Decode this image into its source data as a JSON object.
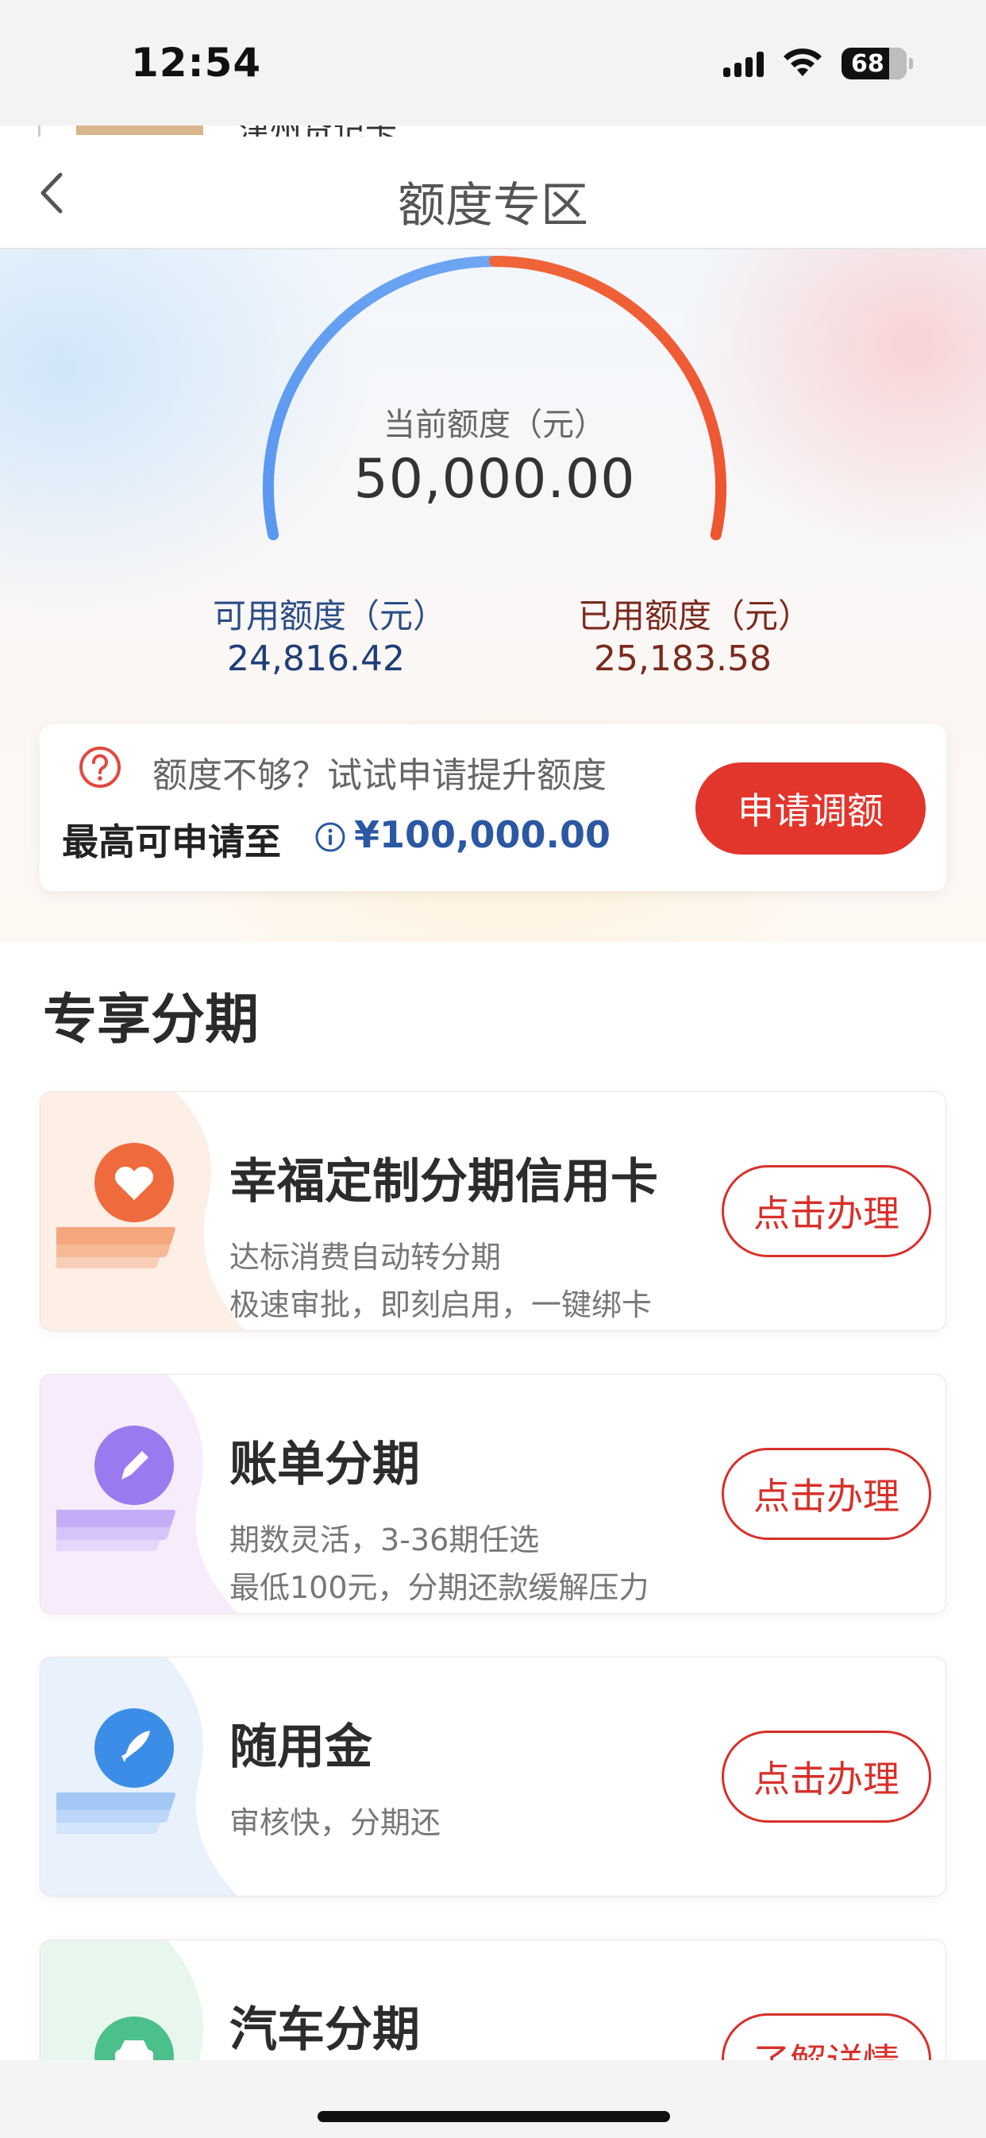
{
  "status_bar": {
    "time": "12:54",
    "battery": "68",
    "icons": [
      "signal-icon",
      "wifi-icon",
      "battery-icon"
    ]
  },
  "background_page": {
    "partial_text": "津州贷记卡"
  },
  "nav": {
    "title": "额度专区",
    "back_icon": "chevron-left-icon"
  },
  "credit": {
    "current_label": "当前额度（元）",
    "current_value": "50,000.00",
    "available_label": "可用额度（元）",
    "available_value": "24,816.42",
    "used_label": "已用额度（元）",
    "used_value": "25,183.58",
    "used_fraction": 0.5037,
    "colors": {
      "available": "#5b9cf0",
      "used": "#ee5a35"
    }
  },
  "quota_card": {
    "hint": "额度不够？试试申请提升额度",
    "max_label": "最高可申请至",
    "max_value": "¥100,000.00",
    "apply_button": "申请调额"
  },
  "section": {
    "title": "专享分期"
  },
  "products": [
    {
      "title": "幸福定制分期信用卡",
      "desc": [
        "达标消费自动转分期",
        "极速审批，即刻启用，一键绑卡"
      ],
      "button": "点击办理",
      "icon": "heart-icon",
      "color": "#ef6b3d"
    },
    {
      "title": "账单分期",
      "desc": [
        "期数灵活，3-36期任选",
        "最低100元，分期还款缓解压力"
      ],
      "button": "点击办理",
      "icon": "pencil-icon",
      "color": "#9b7af0"
    },
    {
      "title": "随用金",
      "desc": [
        "审核快，分期还"
      ],
      "button": "点击办理",
      "icon": "rocket-icon",
      "color": "#3b8de8"
    },
    {
      "title": "汽车分期",
      "desc": [],
      "button": "了解详情",
      "icon": "car-icon",
      "color": "#4bc08a"
    }
  ]
}
